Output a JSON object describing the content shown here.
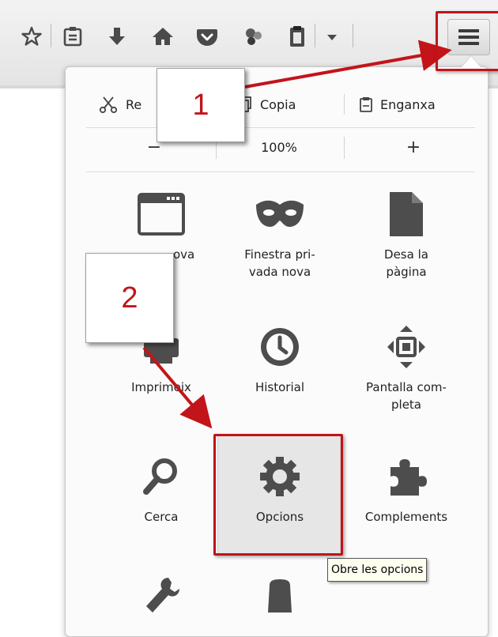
{
  "toolbar": {
    "icons": [
      "bookmark-star-icon",
      "reading-list-icon",
      "downloads-icon",
      "home-icon",
      "pocket-icon",
      "sync-icon",
      "clipboard-icon",
      "dropdown-arrow-icon",
      "hamburger-menu-icon"
    ]
  },
  "menu": {
    "edit": {
      "cut_label": "Re",
      "copy_label": "Copia",
      "paste_label": "Enganxa"
    },
    "zoom": {
      "minus": "−",
      "level": "100%",
      "plus": "+"
    },
    "items": [
      {
        "id": "new-window",
        "label": "ova"
      },
      {
        "id": "private-window",
        "label": "Finestra pri-\nvada nova"
      },
      {
        "id": "save-page",
        "label": "Desa la\npàgina"
      },
      {
        "id": "print",
        "label": "Imprimeix"
      },
      {
        "id": "history",
        "label": "Historial"
      },
      {
        "id": "fullscreen",
        "label": "Pantalla com-\npleta"
      },
      {
        "id": "find",
        "label": "Cerca"
      },
      {
        "id": "options",
        "label": "Opcions"
      },
      {
        "id": "addons",
        "label": "Complements"
      }
    ],
    "tooltip": "Obre les opcions"
  },
  "annotations": {
    "step1": "1",
    "step2": "2",
    "accent_color": "#c3141a"
  }
}
